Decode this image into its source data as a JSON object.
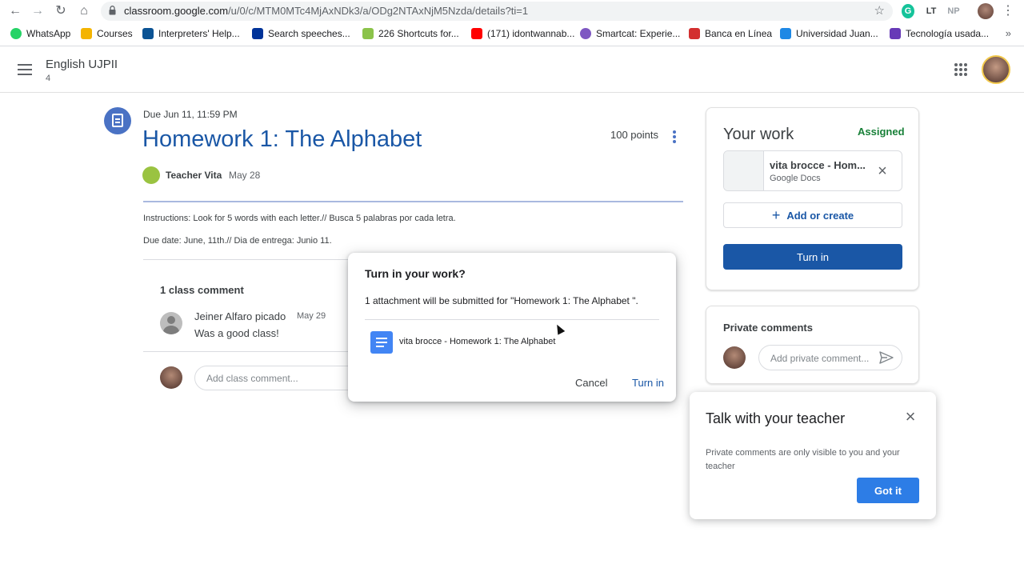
{
  "browser": {
    "url_host": "classroom.google.com",
    "url_path": "/u/0/c/MTM0MTc4MjAxNDk3/a/ODg2NTAxNjM5Nzda/details?ti=1",
    "ext_lt": "LT",
    "ext_np": "NP"
  },
  "bookmarks": [
    {
      "label": "WhatsApp",
      "color": "#25d366"
    },
    {
      "label": "Courses",
      "color": "#f4b400"
    },
    {
      "label": "Interpreters' Help...",
      "color": "#0b5394"
    },
    {
      "label": "Search speeches...",
      "color": "#003399"
    },
    {
      "label": "226 Shortcuts for...",
      "color": "#8bc34a"
    },
    {
      "label": "(171) idontwannab...",
      "color": "#ff0000"
    },
    {
      "label": "Smartcat: Experie...",
      "color": "#7e57c2"
    },
    {
      "label": "Banca en Línea",
      "color": "#d32f2f"
    },
    {
      "label": "Universidad Juan...",
      "color": "#1e88e5"
    },
    {
      "label": "Tecnología usada...",
      "color": "#673ab7"
    }
  ],
  "header": {
    "course_title": "English UJPII",
    "course_section": "4"
  },
  "assignment": {
    "due": "Due Jun 11, 11:59 PM",
    "title": "Homework 1: The Alphabet",
    "points": "100 points",
    "teacher": "Teacher Vita",
    "posted": "May 28",
    "instructions": "Instructions: Look for 5 words with each letter.// Busca 5 palabras por cada letra.",
    "due_date_line": "Due date: June, 11th.// Dia de entrega: Junio 11."
  },
  "class_comments": {
    "title": "1 class comment",
    "comments": [
      {
        "author": "Jeiner Alfaro picado",
        "date": "May 29",
        "text": "Was a good class!"
      }
    ],
    "input_placeholder": "Add class comment..."
  },
  "your_work": {
    "title": "Your work",
    "status": "Assigned",
    "attachment_name": "vita brocce - Hom...",
    "attachment_type": "Google Docs",
    "add_label": "Add or create",
    "turn_in_label": "Turn in"
  },
  "private_comments": {
    "title": "Private comments",
    "placeholder": "Add private comment..."
  },
  "dialog": {
    "title": "Turn in your work?",
    "body": "1 attachment will be submitted for \"Homework 1: The Alphabet \".",
    "doc_name": "vita brocce - Homework 1: The Alphabet",
    "cancel": "Cancel",
    "confirm": "Turn in"
  },
  "tip": {
    "title": "Talk with your teacher",
    "body": "Private comments are only visible to you and your teacher",
    "button": "Got it"
  },
  "colors": {
    "primary_blue": "#1a57a6",
    "assigned_green": "#188038",
    "docs_blue": "#4285f4"
  }
}
